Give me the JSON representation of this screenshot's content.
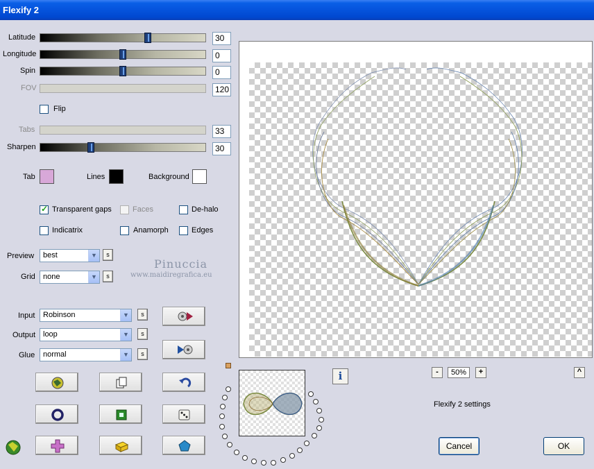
{
  "window": {
    "title": "Flexify 2"
  },
  "params": {
    "latitude": {
      "label": "Latitude",
      "value": "30",
      "level": 0.66
    },
    "longitude": {
      "label": "Longitude",
      "value": "0",
      "level": 0.5
    },
    "spin": {
      "label": "Spin",
      "value": "0",
      "level": 0.5
    },
    "fov": {
      "label": "FOV",
      "value": "120"
    },
    "flip": {
      "label": "Flip",
      "checked": false
    },
    "tabs": {
      "label": "Tabs",
      "value": "33"
    },
    "sharpen": {
      "label": "Sharpen",
      "value": "30",
      "level": 0.3
    }
  },
  "colors": {
    "tab": {
      "label": "Tab",
      "color": "#D8A8D8"
    },
    "lines": {
      "label": "Lines",
      "color": "#000000"
    },
    "background": {
      "label": "Background",
      "color": "#FFFFFF"
    }
  },
  "options": {
    "transparent_gaps": {
      "label": "Transparent gaps",
      "checked": true
    },
    "faces": {
      "label": "Faces",
      "checked": false,
      "disabled": true
    },
    "de_halo": {
      "label": "De-halo",
      "checked": false
    },
    "indicatrix": {
      "label": "Indicatrix",
      "checked": false
    },
    "anamorph": {
      "label": "Anamorph",
      "checked": false
    },
    "edges": {
      "label": "Edges",
      "checked": false
    }
  },
  "selects": {
    "preview": {
      "label": "Preview",
      "value": "best"
    },
    "grid": {
      "label": "Grid",
      "value": "none"
    },
    "input": {
      "label": "Input",
      "value": "Robinson"
    },
    "output": {
      "label": "Output",
      "value": "loop"
    },
    "glue": {
      "label": "Glue",
      "value": "normal"
    }
  },
  "s_label": "s",
  "watermark": {
    "name": "Pinuccia",
    "url": "www.maidiregrafica.eu"
  },
  "zoom": {
    "minus": "-",
    "value": "50%",
    "plus": "+",
    "up": "^"
  },
  "info_label": "i",
  "settings_label": "Flexify 2 settings",
  "buttons": {
    "cancel": "Cancel",
    "ok": "OK"
  }
}
